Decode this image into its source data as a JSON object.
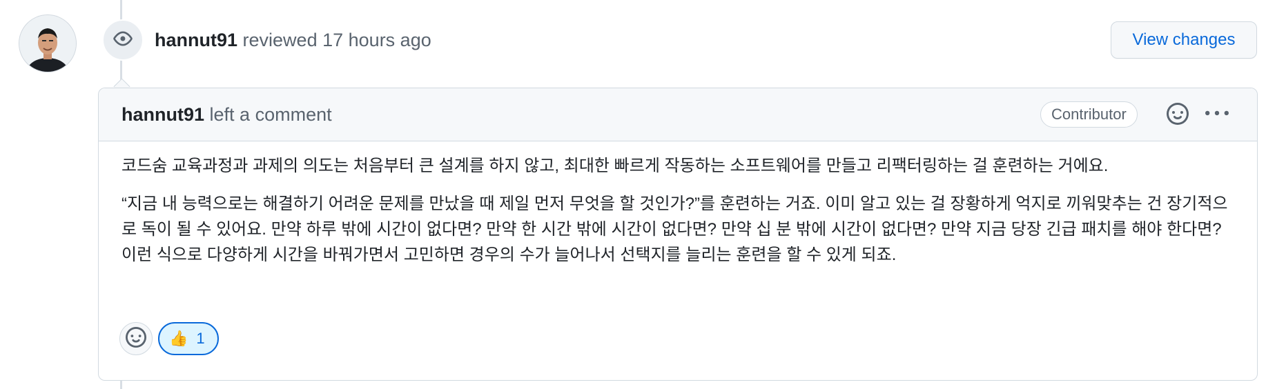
{
  "review_event": {
    "author": "hannut91",
    "action": "reviewed",
    "time": "17 hours ago",
    "view_changes_label": "View changes",
    "icon": "eye-icon"
  },
  "comment": {
    "author": "hannut91",
    "action": "left a comment",
    "role_badge": "Contributor",
    "paragraphs": [
      "코드숨 교육과정과 과제의 의도는 처음부터 큰 설계를 하지 않고, 최대한 빠르게 작동하는 소프트웨어를 만들고 리팩터링하는 걸 훈련하는 거에요.",
      "“지금 내 능력으로는 해결하기 어려운 문제를 만났을 때 제일 먼저 무엇을 할 것인가?”를 훈련하는 거죠. 이미 알고 있는 걸 장황하게 억지로 끼워맞추는 건 장기적으로 독이 될 수 있어요. 만약 하루 밖에 시간이 없다면? 만약 한 시간 밖에 시간이 없다면? 만약 십 분 밖에 시간이 없다면? 만약 지금 당장 긴급 패치를 해야 한다면? 이런 식으로 다양하게 시간을 바꿔가면서 고민하면 경우의 수가 늘어나서 선택지를 늘리는 훈련을 할 수 있게 되죠."
    ],
    "reactions": [
      {
        "emoji": "👍",
        "count": "1"
      }
    ]
  },
  "colors": {
    "link": "#0969da",
    "muted": "#59636e",
    "border": "#d1d9e0",
    "header_bg": "#f6f8fa",
    "reaction_bg": "#ddf4ff"
  }
}
